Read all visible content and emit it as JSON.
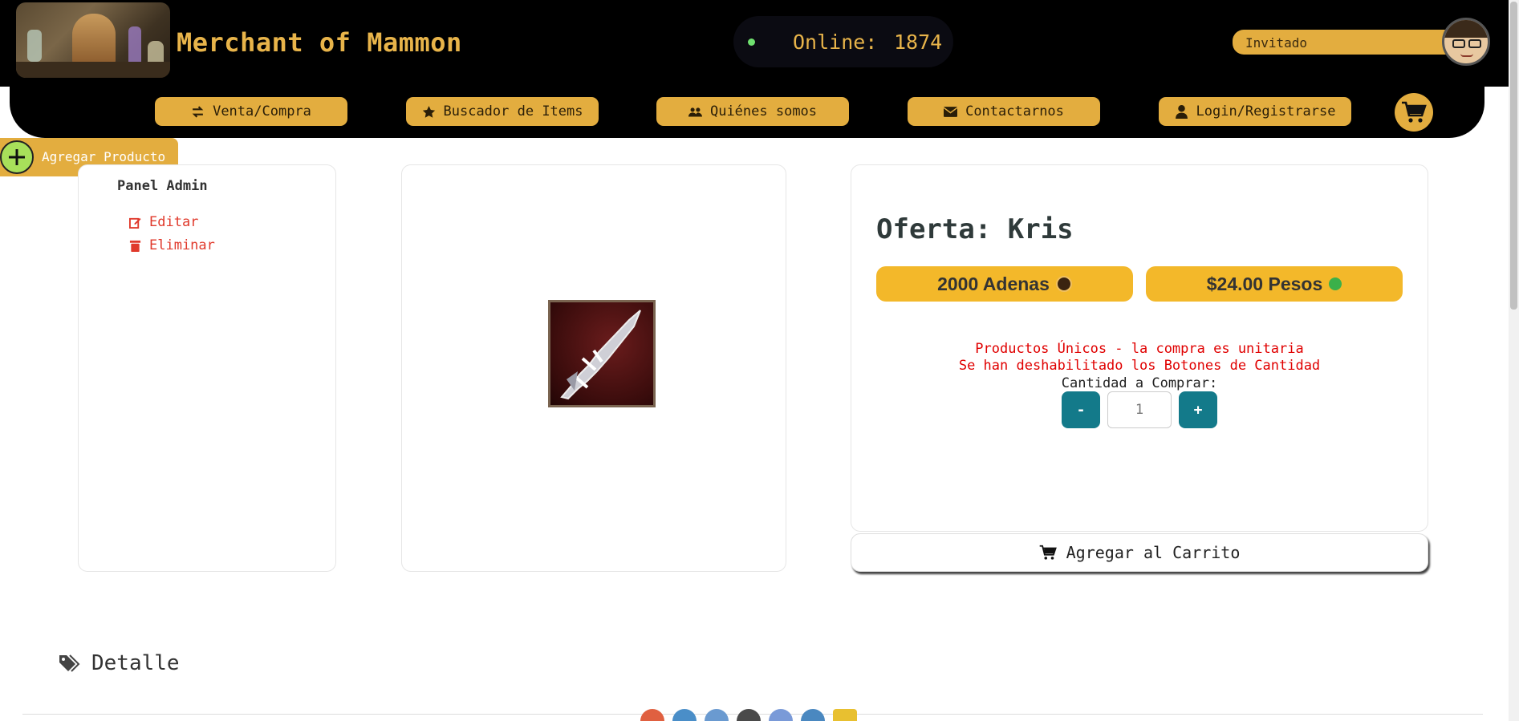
{
  "header": {
    "site_title": "Merchant of Mammon",
    "online_label": "Online:",
    "online_count": "1874",
    "user_name": "Invitado"
  },
  "nav": {
    "items": [
      {
        "label": "Venta/Compra",
        "icon": "exchange-icon"
      },
      {
        "label": "Buscador de Items",
        "icon": "star-icon"
      },
      {
        "label": "Quiénes somos",
        "icon": "users-icon"
      },
      {
        "label": "Contactarnos",
        "icon": "envelope-icon"
      },
      {
        "label": "Login/Registrarse",
        "icon": "user-icon"
      }
    ],
    "cart_icon": "cart-icon"
  },
  "add_product": {
    "label": "Agregar Producto"
  },
  "admin": {
    "title": "Panel Admin",
    "edit_label": "Editar",
    "delete_label": "Eliminar"
  },
  "offer": {
    "title": "Oferta: Kris",
    "price_adena": "2000 Adenas",
    "price_pesos": "$24.00 Pesos",
    "warning_line1": "Productos Únicos - la compra es unitaria",
    "warning_line2": "Se han deshabilitado los Botones de Cantidad",
    "qty_label": "Cantidad a Comprar:",
    "qty_minus": "-",
    "qty_plus": "+",
    "qty_value": "1",
    "add_to_cart": "Agregar al Carrito"
  },
  "detail": {
    "title": "Detalle"
  },
  "colors": {
    "accent": "#e3ad3f",
    "price_pill": "#f3b82a",
    "qty_button": "#137a8a",
    "warning": "#e00000",
    "danger_link": "#e0392b"
  }
}
